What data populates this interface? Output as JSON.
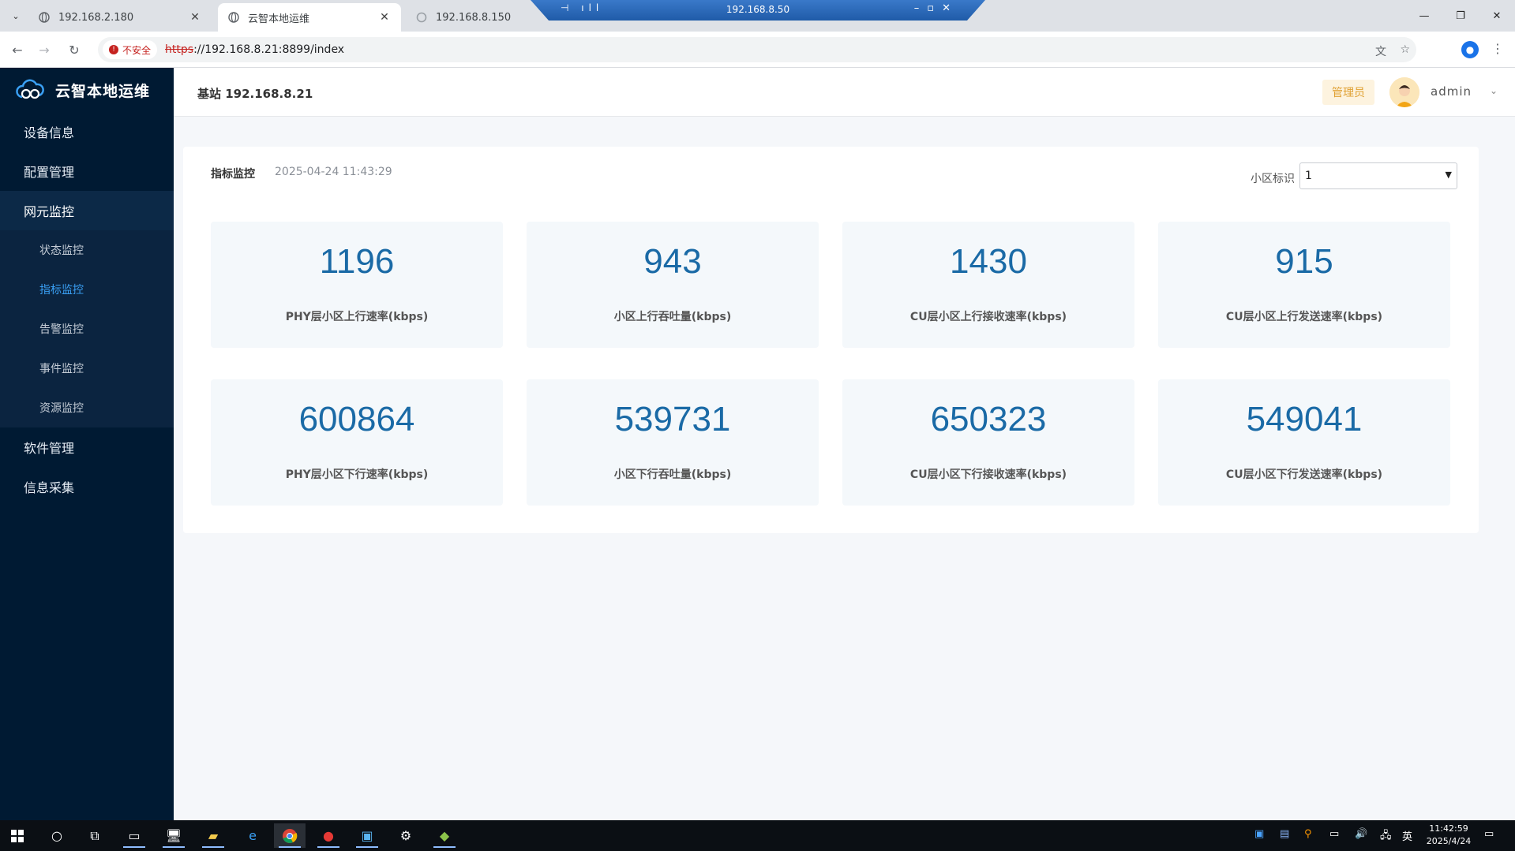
{
  "browser": {
    "tabs": [
      {
        "title": "192.168.2.180"
      },
      {
        "title": "云智本地运维"
      },
      {
        "title": "192.168.8.150"
      }
    ],
    "remote_title": "192.168.8.50",
    "security_label": "不安全",
    "url_scheme": "https",
    "url_rest": "://192.168.8.21:8899/index"
  },
  "app": {
    "brand": "云智本地运维",
    "menu": [
      {
        "label": "设备信息"
      },
      {
        "label": "配置管理"
      },
      {
        "label": "网元监控"
      },
      {
        "label": "软件管理"
      },
      {
        "label": "信息采集"
      }
    ],
    "submenu": [
      {
        "label": "状态监控"
      },
      {
        "label": "指标监控"
      },
      {
        "label": "告警监控"
      },
      {
        "label": "事件监控"
      },
      {
        "label": "资源监控"
      }
    ],
    "header": {
      "station": "基站 192.168.8.21",
      "role": "管理员",
      "username": "admin"
    }
  },
  "panel": {
    "title": "指标监控",
    "timestamp": "2025-04-24 11:43:29",
    "cell_label": "小区标识",
    "cell_value": "1",
    "metrics": [
      {
        "value": "1196",
        "label": "PHY层小区上行速率(kbps)"
      },
      {
        "value": "943",
        "label": "小区上行吞吐量(kbps)"
      },
      {
        "value": "1430",
        "label": "CU层小区上行接收速率(kbps)"
      },
      {
        "value": "915",
        "label": "CU层小区上行发送速率(kbps)"
      },
      {
        "value": "600864",
        "label": "PHY层小区下行速率(kbps)"
      },
      {
        "value": "539731",
        "label": "小区下行吞吐量(kbps)"
      },
      {
        "value": "650323",
        "label": "CU层小区下行接收速率(kbps)"
      },
      {
        "value": "549041",
        "label": "CU层小区下行发送速率(kbps)"
      }
    ]
  },
  "taskbar": {
    "ime": "英",
    "time": "11:42:59",
    "date": "2025/4/24"
  },
  "colors": {
    "sidebar_bg": "#001a33",
    "active_submenu": "#3aa0f5",
    "metric_value": "#1a6aa6",
    "role_badge_bg": "#fdf3df",
    "role_badge_text": "#e0a032"
  }
}
